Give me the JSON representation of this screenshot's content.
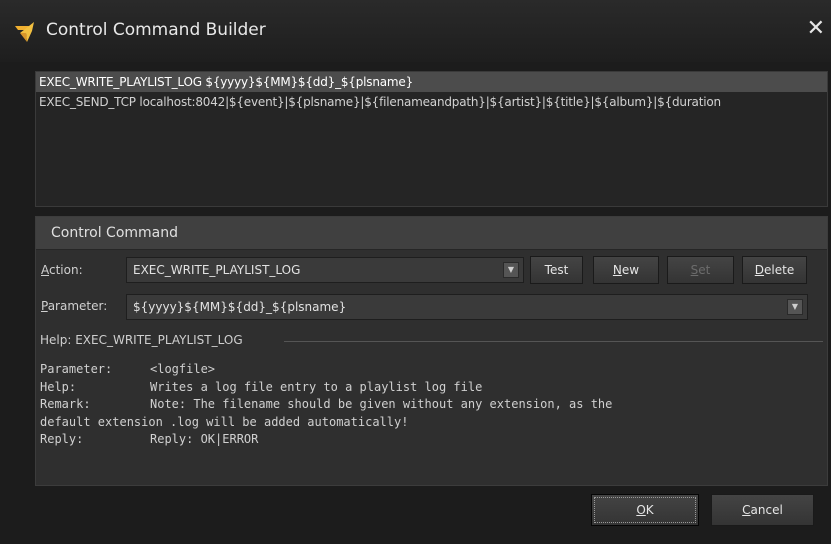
{
  "window": {
    "title": "Control Command Builder"
  },
  "command_list": [
    "EXEC_WRITE_PLAYLIST_LOG ${yyyy}${MM}${dd}_${plsname}",
    "EXEC_SEND_TCP localhost:8042|${event}|${plsname}|${filenameandpath}|${artist}|${title}|${album}|${duration"
  ],
  "control_command": {
    "header": "Control Command",
    "action_label": "Action:",
    "action_value": "EXEC_WRITE_PLAYLIST_LOG",
    "parameter_label": "Parameter:",
    "parameter_value": "${yyyy}${MM}${dd}_${plsname}",
    "buttons": {
      "test": "Test",
      "new": "New",
      "set": "Set",
      "delete": "Delete"
    }
  },
  "help": {
    "title": "Help: EXEC_WRITE_PLAYLIST_LOG",
    "parameter_key": "Parameter:",
    "parameter_val": "<logfile>",
    "help_key": "Help:",
    "help_val": "Writes a log file entry to a playlist log file",
    "remark_key": "Remark:",
    "remark_val": "Note: The filename should be given without any extension, as the",
    "remark_cont": "default extension .log will be added automatically!",
    "reply_key": "Reply:",
    "reply_val": "Reply: OK|ERROR"
  },
  "footer": {
    "ok": "OK",
    "cancel": "Cancel"
  }
}
